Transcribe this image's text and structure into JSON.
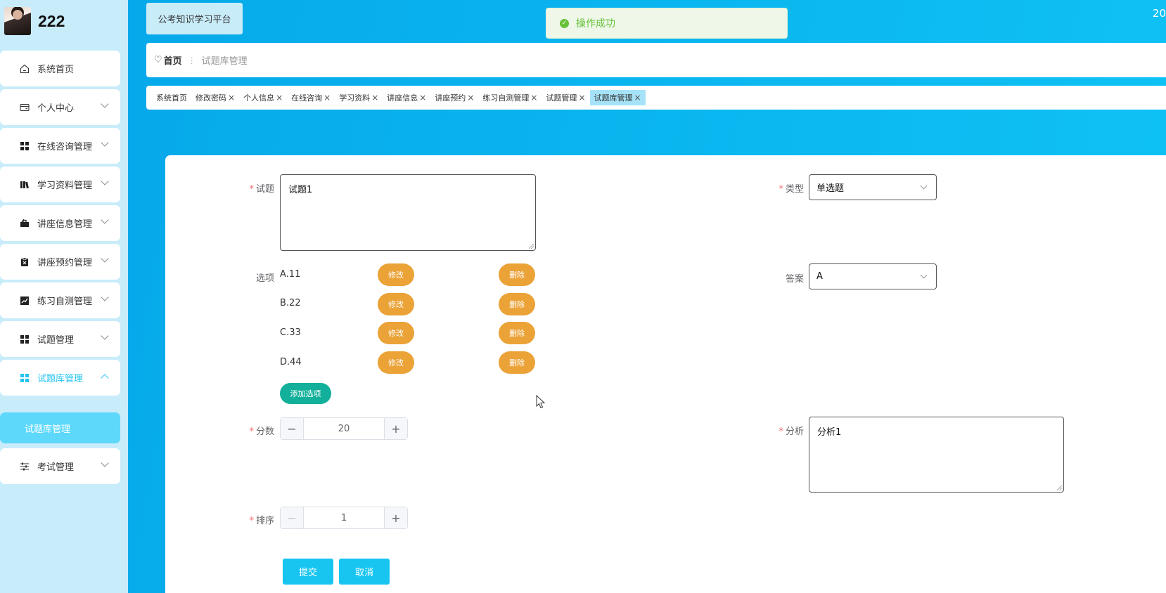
{
  "sidebar": {
    "brand_name": "222",
    "items": [
      {
        "label": "系统首页",
        "icon": "home-icon"
      },
      {
        "label": "个人中心",
        "icon": "wallet-icon"
      },
      {
        "label": "在线咨询管理",
        "icon": "grid-icon"
      },
      {
        "label": "学习资料管理",
        "icon": "books-icon"
      },
      {
        "label": "讲座信息管理",
        "icon": "briefcase-icon"
      },
      {
        "label": "讲座预约管理",
        "icon": "clipboard-icon"
      },
      {
        "label": "练习自测管理",
        "icon": "chart-icon"
      },
      {
        "label": "试题管理",
        "icon": "grid-icon"
      },
      {
        "label": "试题库管理",
        "icon": "grid-icon"
      },
      {
        "label": "考试管理",
        "icon": "sliders-icon"
      }
    ],
    "submenu": {
      "label": "试题库管理"
    }
  },
  "header": {
    "app_title": "公考知识学习平台",
    "toast": "操作成功",
    "top_right": "20"
  },
  "breadcrumb": {
    "home": "首页",
    "current": "试题库管理"
  },
  "tabs": [
    "系统首页",
    "修改密码",
    "个人信息",
    "在线咨询",
    "学习资料",
    "讲座信息",
    "讲座预约",
    "练习自测管理",
    "试题管理",
    "试题库管理"
  ],
  "form": {
    "question_label": "试题",
    "question_value": "试题1",
    "type_label": "类型",
    "type_value": "单选题",
    "options_label": "选项",
    "options": [
      "A.11",
      "B.22",
      "C.33",
      "D.44"
    ],
    "edit_label": "修改",
    "delete_label": "删除",
    "add_option_label": "添加选项",
    "answer_label": "答案",
    "answer_value": "A",
    "score_label": "分数",
    "score_value": "20",
    "analysis_label": "分析",
    "analysis_value": "分析1",
    "order_label": "排序",
    "order_value": "1",
    "submit_label": "提交",
    "cancel_label": "取消"
  },
  "colors": {
    "accent": "#17c5f0",
    "option_button": "#eba237",
    "add_button": "#12b09a",
    "toast_text": "#67c23a"
  }
}
